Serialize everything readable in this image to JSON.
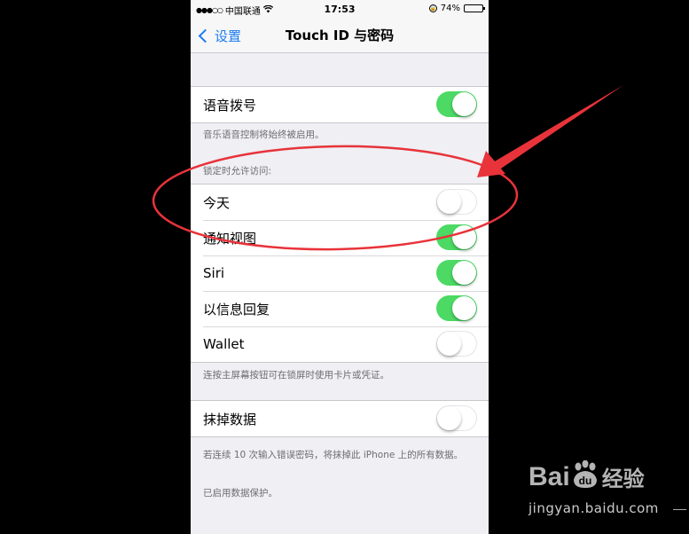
{
  "statusbar": {
    "signal": "●●●○○",
    "carrier": "中国联通",
    "wifi_icon": "wifi-icon",
    "time": "17:53",
    "rotation_lock_icon": "rotation-lock-icon",
    "battery_percent": "74%",
    "battery_level": 0.74
  },
  "navbar": {
    "back_label": "设置",
    "title": "Touch ID 与密码"
  },
  "voice_dial": {
    "label": "语音拨号",
    "on": true,
    "footer": "音乐语音控制将始终被启用。"
  },
  "lock_access": {
    "header": "锁定时允许访问:",
    "items": [
      {
        "label": "今天",
        "on": false
      },
      {
        "label": "通知视图",
        "on": true
      },
      {
        "label": "Siri",
        "on": true
      },
      {
        "label": "以信息回复",
        "on": true
      },
      {
        "label": "Wallet",
        "on": false
      }
    ],
    "footer": "连按主屏幕按钮可在锁屏时使用卡片或凭证。"
  },
  "erase_data": {
    "label": "抹掉数据",
    "on": false,
    "footer": "若连续 10 次输入错误密码，将抹掉此 iPhone 上的所有数据。",
    "footer2": "已启用数据保护。"
  },
  "colors": {
    "accent_blue": "#1a7cf4",
    "toggle_on": "#4cd964",
    "annotation_red": "#e8333a"
  },
  "watermark": {
    "logo_text_left": "Bai",
    "logo_paw_text": "du",
    "logo_text_cn": "经验",
    "url": "jingyan.baidu.com"
  }
}
